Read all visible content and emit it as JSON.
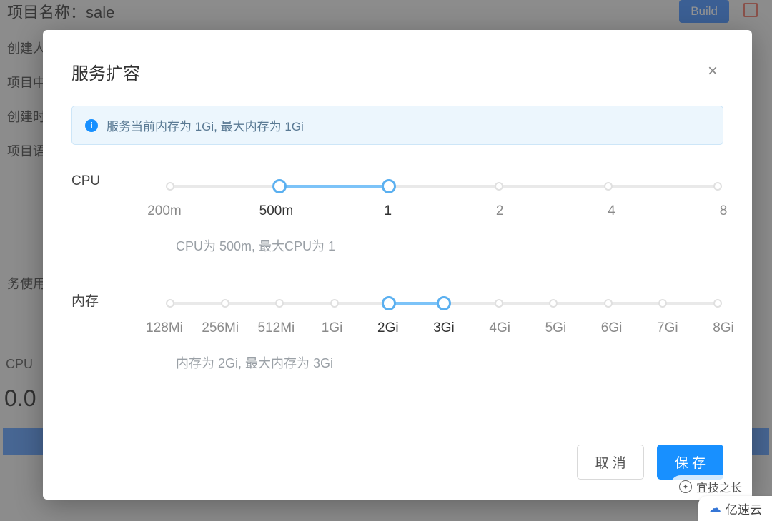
{
  "background": {
    "title_label": "项目名称：",
    "title_value": "sale",
    "rows": [
      "创建人",
      "项目中",
      "创建时",
      "项目语",
      "务使用",
      "CPU",
      "0.0"
    ],
    "build_btn": "Build"
  },
  "modal": {
    "title": "服务扩容",
    "close": "×",
    "banner": "服务当前内存为 1Gi, 最大内存为 1Gi",
    "cpu": {
      "label": "CPU",
      "ticks": [
        "200m",
        "500m",
        "1",
        "2",
        "4",
        "8"
      ],
      "active": [
        1,
        2
      ],
      "helper": "CPU为 500m, 最大CPU为 1"
    },
    "mem": {
      "label": "内存",
      "ticks": [
        "128Mi",
        "256Mi",
        "512Mi",
        "1Gi",
        "2Gi",
        "3Gi",
        "4Gi",
        "5Gi",
        "6Gi",
        "7Gi",
        "8Gi"
      ],
      "active": [
        4,
        5
      ],
      "helper": "内存为 2Gi, 最大内存为 3Gi"
    },
    "cancel": "取 消",
    "save": "保 存"
  },
  "watermark1": "宜技之长",
  "watermark2": "亿速云"
}
